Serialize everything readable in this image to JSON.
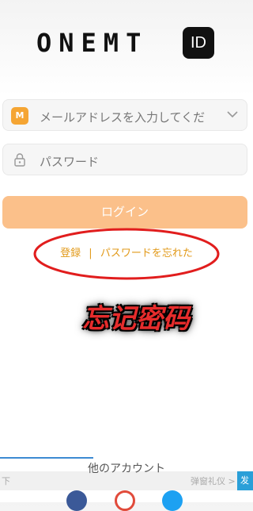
{
  "logo": {
    "wordmark": "ONEMT",
    "badge": "ID"
  },
  "form": {
    "email_placeholder": "メールアドレスを入力してくだ",
    "password_placeholder": "パスワード",
    "login_label": "ログイン"
  },
  "links": {
    "register": "登録",
    "separator": "|",
    "forgot": "パスワードを忘れた"
  },
  "overlay": {
    "chinese_text": "忘记密码"
  },
  "footer": {
    "other_accounts": "他のアカウント",
    "banner_left": "下",
    "banner_right": "弹窗礼仪 >",
    "banner_button": "发"
  },
  "colors": {
    "accent": "#f5a533",
    "button": "#fbc08a",
    "link": "#e29a1a",
    "annotation": "#e62c2c"
  }
}
